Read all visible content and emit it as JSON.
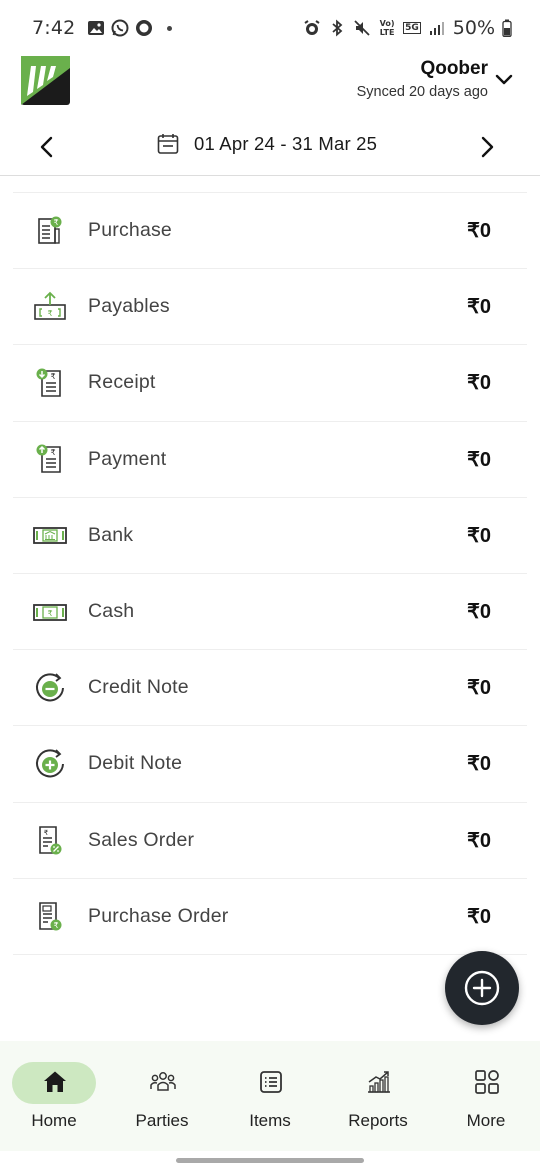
{
  "status_bar": {
    "time": "7:42",
    "battery": "50%",
    "signal_label": "Vo) LTE",
    "network_label": "5G"
  },
  "header": {
    "company_name": "Qoober",
    "sync_status": "Synced 20 days ago"
  },
  "date_range": {
    "label": "01 Apr 24 - 31 Mar 25"
  },
  "summary_items": [
    {
      "label": "Purchase",
      "amount": "₹0",
      "icon": "purchase-bill-icon"
    },
    {
      "label": "Payables",
      "amount": "₹0",
      "icon": "payables-icon"
    },
    {
      "label": "Receipt",
      "amount": "₹0",
      "icon": "receipt-icon"
    },
    {
      "label": "Payment",
      "amount": "₹0",
      "icon": "payment-icon"
    },
    {
      "label": "Bank",
      "amount": "₹0",
      "icon": "bank-note-icon"
    },
    {
      "label": "Cash",
      "amount": "₹0",
      "icon": "cash-note-icon"
    },
    {
      "label": "Credit Note",
      "amount": "₹0",
      "icon": "credit-note-icon"
    },
    {
      "label": "Debit Note",
      "amount": "₹0",
      "icon": "debit-note-icon"
    },
    {
      "label": "Sales Order",
      "amount": "₹0",
      "icon": "sales-order-icon"
    },
    {
      "label": "Purchase Order",
      "amount": "₹0",
      "icon": "purchase-order-icon"
    }
  ],
  "bottom_nav": [
    {
      "label": "Home",
      "icon": "home-icon",
      "active": true
    },
    {
      "label": "Parties",
      "icon": "parties-icon",
      "active": false
    },
    {
      "label": "Items",
      "icon": "items-icon",
      "active": false
    },
    {
      "label": "Reports",
      "icon": "reports-icon",
      "active": false
    },
    {
      "label": "More",
      "icon": "more-grid-icon",
      "active": false
    }
  ],
  "colors": {
    "accent_green": "#6ab04c",
    "active_nav_bg": "#cde8c1",
    "fab_bg": "#22272d",
    "nav_bg": "#f6faf4"
  }
}
